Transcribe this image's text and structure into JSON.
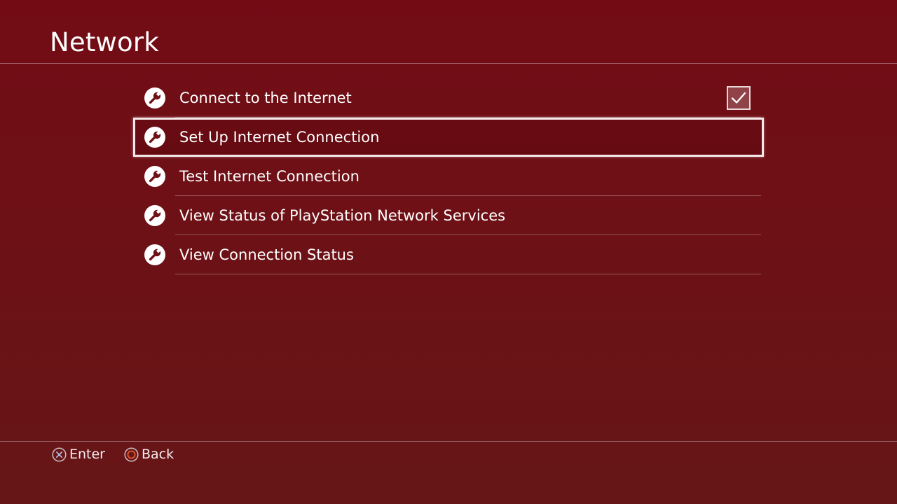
{
  "header": {
    "title": "Network"
  },
  "menu": {
    "items": [
      {
        "label": "Connect to the Internet",
        "icon": "wrench-icon",
        "checkbox": true,
        "checked": true
      },
      {
        "label": "Set Up Internet Connection",
        "icon": "wrench-icon",
        "selected": true
      },
      {
        "label": "Test Internet Connection",
        "icon": "wrench-icon"
      },
      {
        "label": "View Status of PlayStation Network Services",
        "icon": "wrench-icon"
      },
      {
        "label": "View Connection Status",
        "icon": "wrench-icon"
      }
    ]
  },
  "footer": {
    "enter": {
      "label": "Enter",
      "icon": "cross-button-icon"
    },
    "back": {
      "label": "Back",
      "icon": "circle-button-icon",
      "accent": "#e25a2f"
    }
  },
  "colors": {
    "background": "#6d1116",
    "text": "#ffffff",
    "selection_border": "#f4e7e7"
  }
}
